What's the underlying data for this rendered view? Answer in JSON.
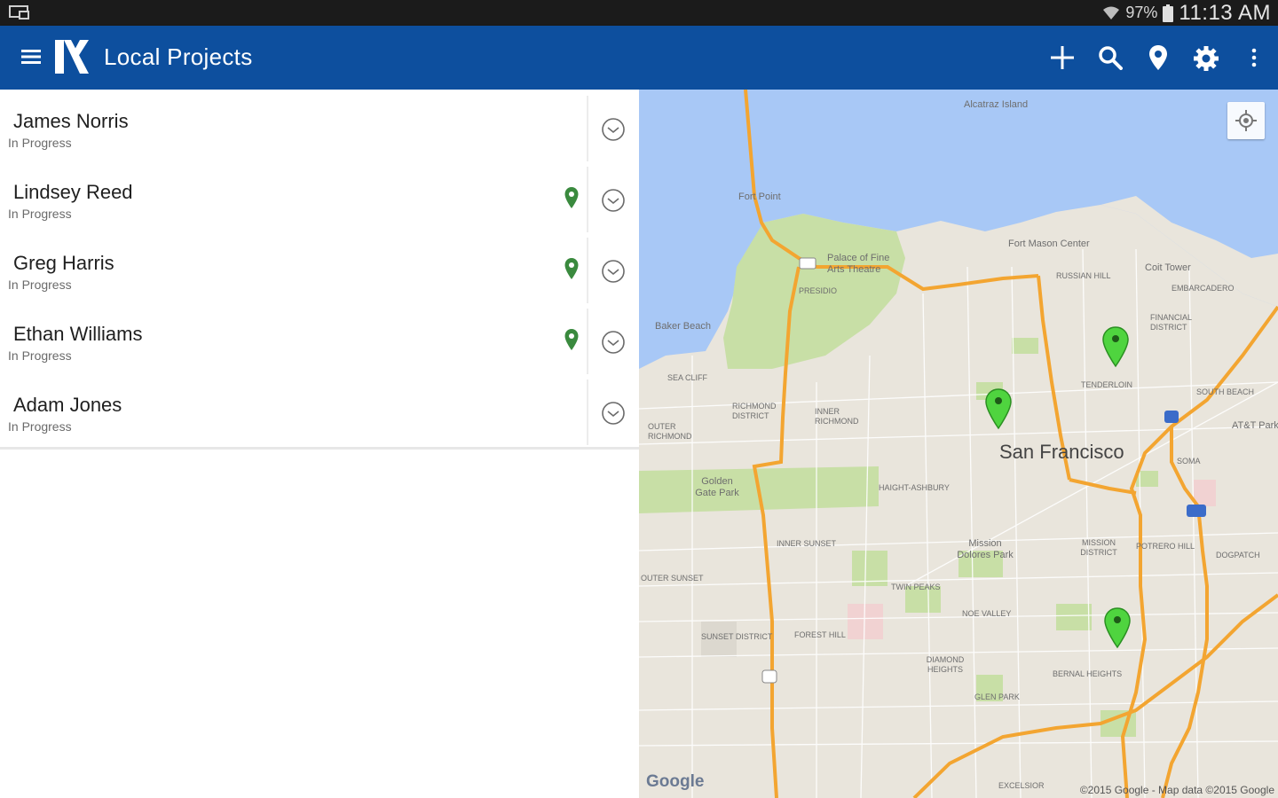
{
  "status_bar": {
    "battery": "97%",
    "time": "11:13 AM"
  },
  "app_bar": {
    "title": "Local Projects"
  },
  "projects": [
    {
      "name": "James Norris",
      "status": "In Progress",
      "has_location": false
    },
    {
      "name": "Lindsey Reed",
      "status": "In Progress",
      "has_location": true
    },
    {
      "name": "Greg Harris",
      "status": "In Progress",
      "has_location": true
    },
    {
      "name": "Ethan Williams",
      "status": "In Progress",
      "has_location": true
    },
    {
      "name": "Adam Jones",
      "status": "In Progress",
      "has_location": false
    }
  ],
  "map": {
    "city_label": "San Francisco",
    "labels": [
      "Alcatraz Island",
      "Fort Point",
      "Fort Mason Center",
      "Coit Tower",
      "Palace of Fine Arts Theatre",
      "Baker Beach",
      "Golden Gate Park",
      "Mission Dolores Park",
      "AT&T Park",
      "SEA CLIFF",
      "RICHMOND DISTRICT",
      "INNER RICHMOND",
      "OUTER RICHMOND",
      "INNER SUNSET",
      "OUTER SUNSET",
      "SUNSET DISTRICT",
      "TWIN PEAKS",
      "NOE VALLEY",
      "DIAMOND HEIGHTS",
      "GLEN PARK",
      "BERNAL HEIGHTS",
      "MISSION DISTRICT",
      "POTRERO HILL",
      "DOGPATCH",
      "TENDERLOIN",
      "FINANCIAL DISTRICT",
      "SOUTH BEACH",
      "SOMA",
      "RUSSIAN HILL",
      "EMBARCADERO",
      "PRESIDIO",
      "HAIGHT-ASHBURY",
      "FOREST HILL",
      "EXCELSIOR"
    ],
    "pins": 3,
    "pin_color": "#4fd43f",
    "logo": "Google",
    "attribution": "©2015 Google - Map data ©2015 Google"
  },
  "colors": {
    "app_bar": "#0d4f9e",
    "status_bar": "#1b1b1b",
    "highway": "#f3a531",
    "water": "#a8c8f6",
    "park": "#c8dfa6",
    "pin_list": "#3a8a3e"
  }
}
